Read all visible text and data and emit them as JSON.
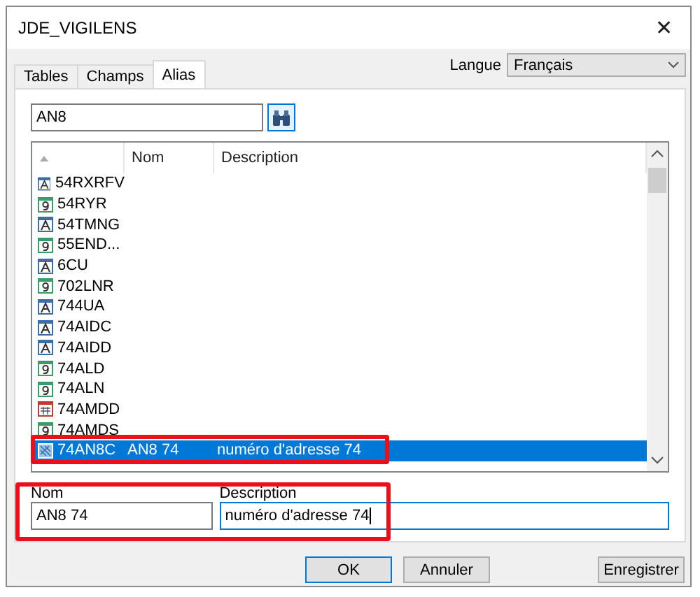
{
  "window": {
    "title": "JDE_VIGILENS",
    "close": "✕"
  },
  "tabs": [
    {
      "label": "Tables",
      "selected": false
    },
    {
      "label": "Champs",
      "selected": false
    },
    {
      "label": "Alias",
      "selected": true
    }
  ],
  "language": {
    "label": "Langue",
    "value": "Français"
  },
  "search": {
    "value": "AN8"
  },
  "table": {
    "columns": [
      "Nom",
      "Description"
    ],
    "rows": [
      {
        "kind": "alpha",
        "alias": "54RXRFV",
        "selected": false
      },
      {
        "kind": "numeric",
        "alias": "54RYR",
        "selected": false
      },
      {
        "kind": "alpha",
        "alias": "54TMNG",
        "selected": false
      },
      {
        "kind": "numeric",
        "alias": "55END...",
        "selected": false
      },
      {
        "kind": "alpha",
        "alias": "6CU",
        "selected": false
      },
      {
        "kind": "numeric",
        "alias": "702LNR",
        "selected": false
      },
      {
        "kind": "alpha",
        "alias": "744UA",
        "selected": false
      },
      {
        "kind": "alpha",
        "alias": "74AIDC",
        "selected": false
      },
      {
        "kind": "alpha",
        "alias": "74AIDD",
        "selected": false
      },
      {
        "kind": "numeric",
        "alias": "74ALD",
        "selected": false
      },
      {
        "kind": "numeric",
        "alias": "74ALN",
        "selected": false
      },
      {
        "kind": "date",
        "alias": "74AMDD",
        "selected": false
      },
      {
        "kind": "numeric",
        "alias": "74AMDS",
        "selected": false
      },
      {
        "kind": "binary",
        "alias": "74AN8C",
        "name": "AN8 74",
        "description": "numéro d'adresse 74",
        "selected": true
      }
    ]
  },
  "editor": {
    "name_label": "Nom",
    "name_value": "AN8 74",
    "description_label": "Description",
    "description_value": "numéro d'adresse 74"
  },
  "buttons": [
    {
      "label": "OK",
      "default": true
    },
    {
      "label": "Annuler",
      "default": false
    },
    {
      "label": "Enregistrer",
      "default": false
    }
  ]
}
